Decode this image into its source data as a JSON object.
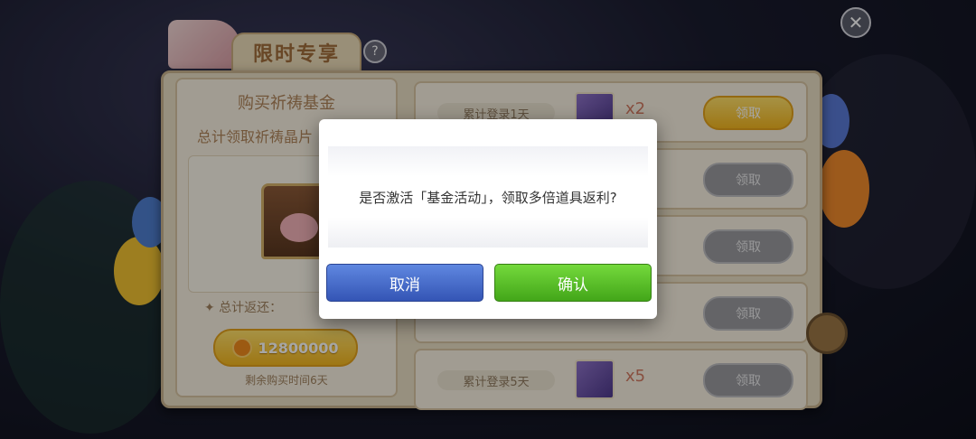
{
  "header": {
    "title": "限时专享",
    "help_label": "?",
    "close_label": "✕"
  },
  "fund_card": {
    "title": "购买祈祷基金",
    "subtitle": "总计领取祈祷晶片",
    "return_label": "总计返还：",
    "price": "12800000",
    "remaining_time": "剩余购买时间6天"
  },
  "rewards": [
    {
      "day_label": "累计登录1天",
      "multiplier": "x2",
      "claim_label": "领取",
      "state": "active"
    },
    {
      "day_label": "",
      "multiplier": "",
      "claim_label": "领取",
      "state": "disabled"
    },
    {
      "day_label": "",
      "multiplier": "",
      "claim_label": "领取",
      "state": "disabled"
    },
    {
      "day_label": "",
      "multiplier": "",
      "claim_label": "领取",
      "state": "disabled"
    },
    {
      "day_label": "累计登录5天",
      "multiplier": "x5",
      "claim_label": "领取",
      "state": "disabled"
    }
  ],
  "dialog": {
    "message": "是否激活「基金活动」，领取多倍道具返利?",
    "cancel_label": "取消",
    "confirm_label": "确认"
  },
  "colors": {
    "cancel": "#3f66c9",
    "confirm": "#58bf27",
    "claim_active": "#f3b61f",
    "claim_disabled": "#9a9a9f"
  }
}
